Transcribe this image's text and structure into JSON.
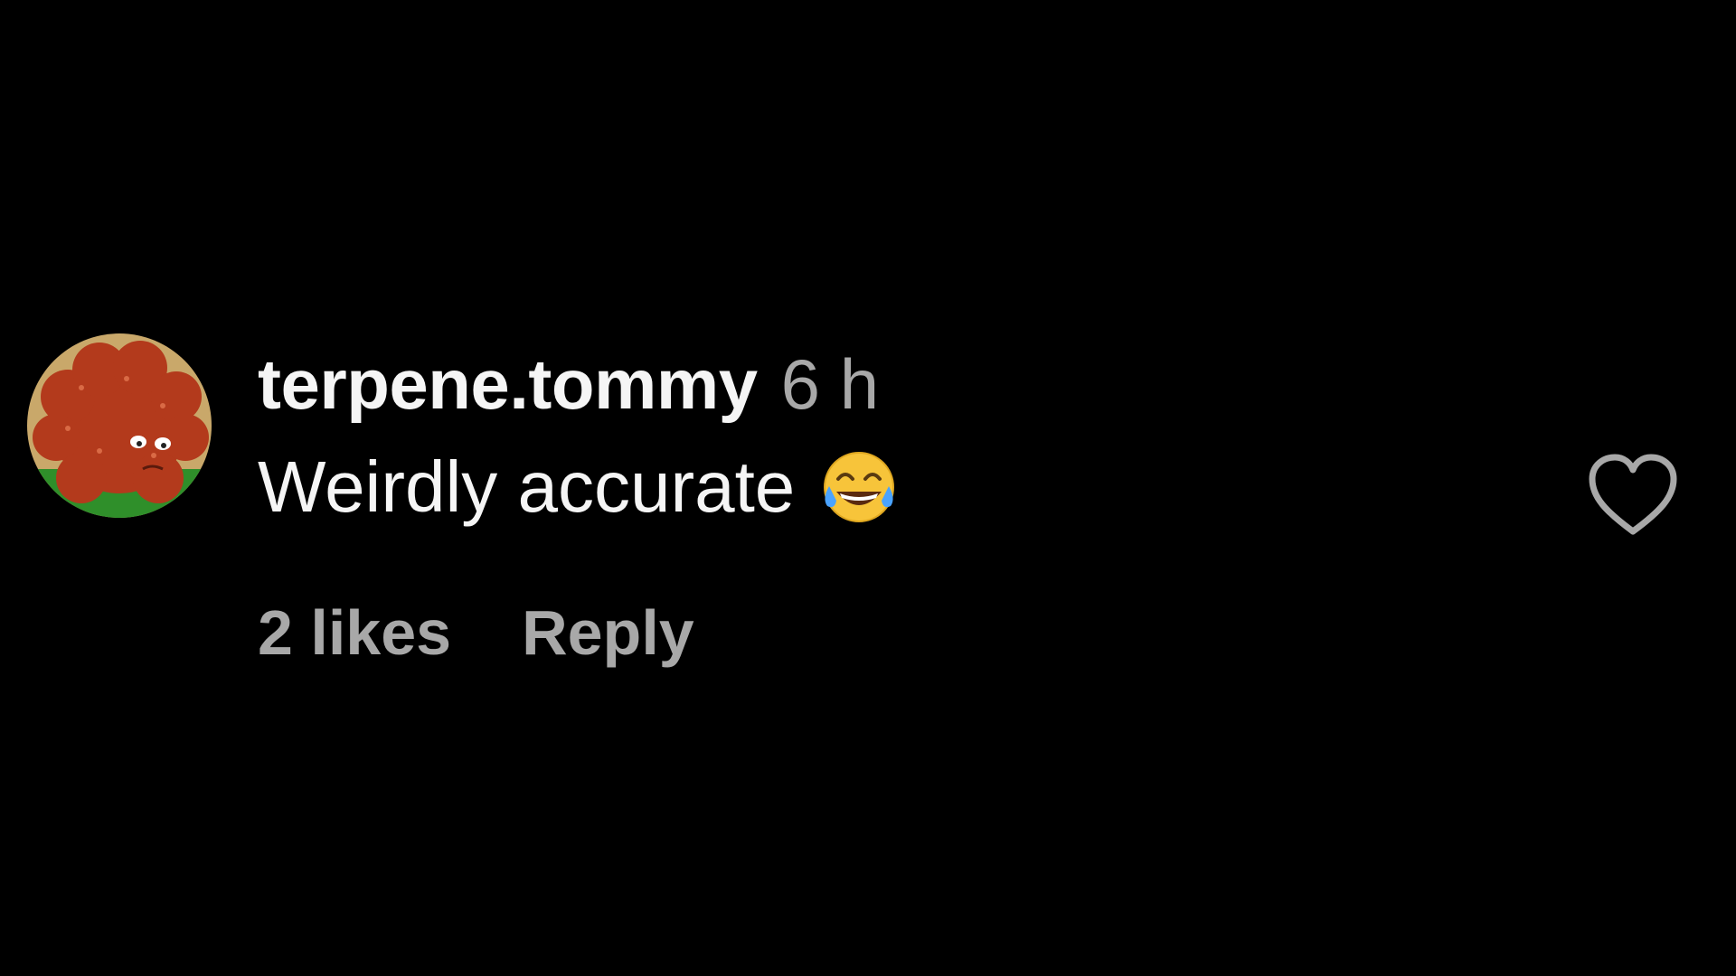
{
  "comment": {
    "username": "terpene.tommy",
    "timestamp": "6 h",
    "text": "Weirdly accurate",
    "emoji": "face-with-tears-of-joy-icon",
    "likes_label": "2 likes",
    "reply_label": "Reply"
  },
  "colors": {
    "background": "#000000",
    "primary_text": "#f5f5f5",
    "secondary_text": "#a8a8a8",
    "avatar_main": "#b33a1c",
    "avatar_ground": "#2f8f2a",
    "avatar_bg": "#c9a86a"
  },
  "icons": {
    "avatar": "avatar",
    "emoji": "face-with-tears-of-joy-icon",
    "like": "heart-outline-icon"
  }
}
